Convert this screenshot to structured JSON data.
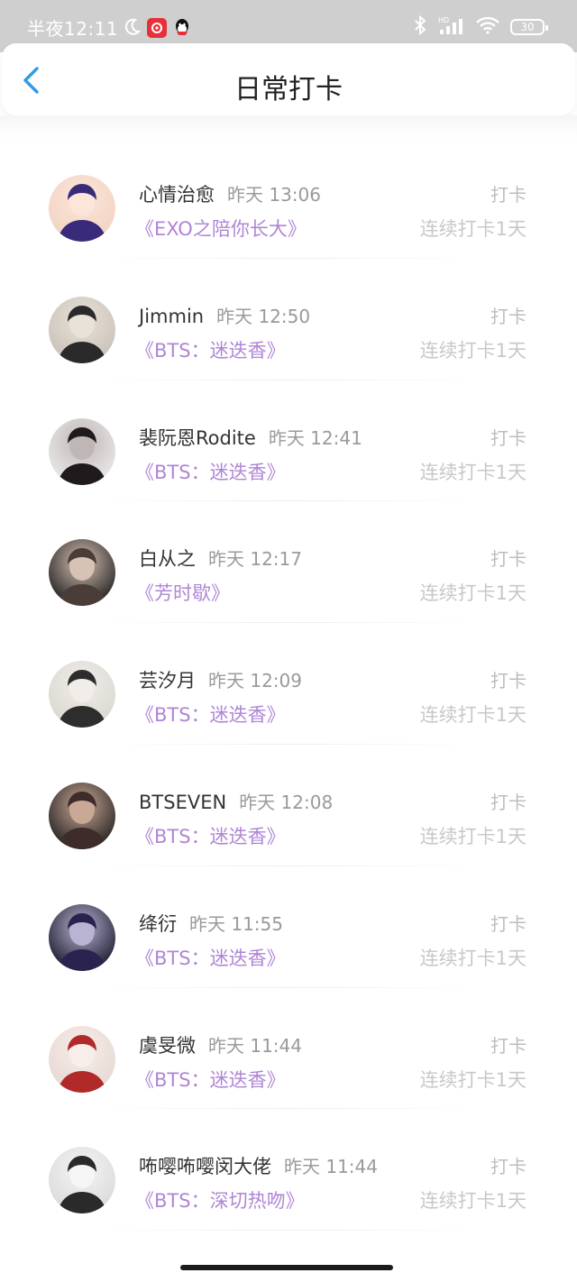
{
  "status_bar": {
    "time": "半夜12:11",
    "battery": "30",
    "icons": [
      "moon-icon",
      "netease-music-icon",
      "qq-icon",
      "bluetooth-icon",
      "signal-icon",
      "wifi-icon",
      "battery-icon"
    ],
    "hd_label": "HD"
  },
  "header": {
    "title": "日常打卡",
    "back_icon": "chevron-left-icon",
    "accent": "#2f9be8"
  },
  "colors": {
    "book": "#b085d6",
    "muted": "#bdbdbd"
  },
  "checkins": [
    {
      "name": "心情治愈",
      "time": "昨天 13:06",
      "tag": "打卡",
      "book": "《EXO之陪你长大》",
      "streak": "连续打卡1天",
      "avatar": [
        "#f2d2c2",
        "#3a2a7a",
        "#fbe6d9"
      ]
    },
    {
      "name": "Jimmin",
      "time": "昨天 12:50",
      "tag": "打卡",
      "book": "《BTS：迷迭香》",
      "streak": "连续打卡1天",
      "avatar": [
        "#c8c0b6",
        "#2a2a2a",
        "#e9e2d8"
      ]
    },
    {
      "name": "裴阮恩Rodite",
      "time": "昨天 12:41",
      "tag": "打卡",
      "book": "《BTS：迷迭香》",
      "streak": "连续打卡1天",
      "avatar": [
        "#ececec",
        "#1f1b1d",
        "#bfb7b5"
      ]
    },
    {
      "name": "白从之",
      "time": "昨天 12:17",
      "tag": "打卡",
      "book": "《芳时歇》",
      "streak": "连续打卡1天",
      "avatar": [
        "#1a1a1a",
        "#4a3c36",
        "#d8c2b6"
      ]
    },
    {
      "name": "芸汐月",
      "time": "昨天 12:09",
      "tag": "打卡",
      "book": "《BTS：迷迭香》",
      "streak": "连续打卡1天",
      "avatar": [
        "#d9d6d0",
        "#2d2d2d",
        "#f1eee9"
      ]
    },
    {
      "name": "BTSEVEN",
      "time": "昨天 12:08",
      "tag": "打卡",
      "book": "《BTS：迷迭香》",
      "streak": "连续打卡1天",
      "avatar": [
        "#1c1c1c",
        "#3d2c2a",
        "#caa896"
      ]
    },
    {
      "name": "绛衍",
      "time": "昨天 11:55",
      "tag": "打卡",
      "book": "《BTS：迷迭香》",
      "streak": "连续打卡1天",
      "avatar": [
        "#141428",
        "#2a2350",
        "#b9b4d2"
      ]
    },
    {
      "name": "虞旻微",
      "time": "昨天 11:44",
      "tag": "打卡",
      "book": "《BTS：迷迭香》",
      "streak": "连续打卡1天",
      "avatar": [
        "#e6d7d2",
        "#b02a2a",
        "#f7eeea"
      ]
    },
    {
      "name": "咘嘤咘嘤闵大佬",
      "time": "昨天 11:44",
      "tag": "打卡",
      "book": "《BTS：深切热吻》",
      "streak": "连续打卡1天",
      "avatar": [
        "#d9d9d9",
        "#2a2a2a",
        "#f5f5f5"
      ]
    }
  ]
}
